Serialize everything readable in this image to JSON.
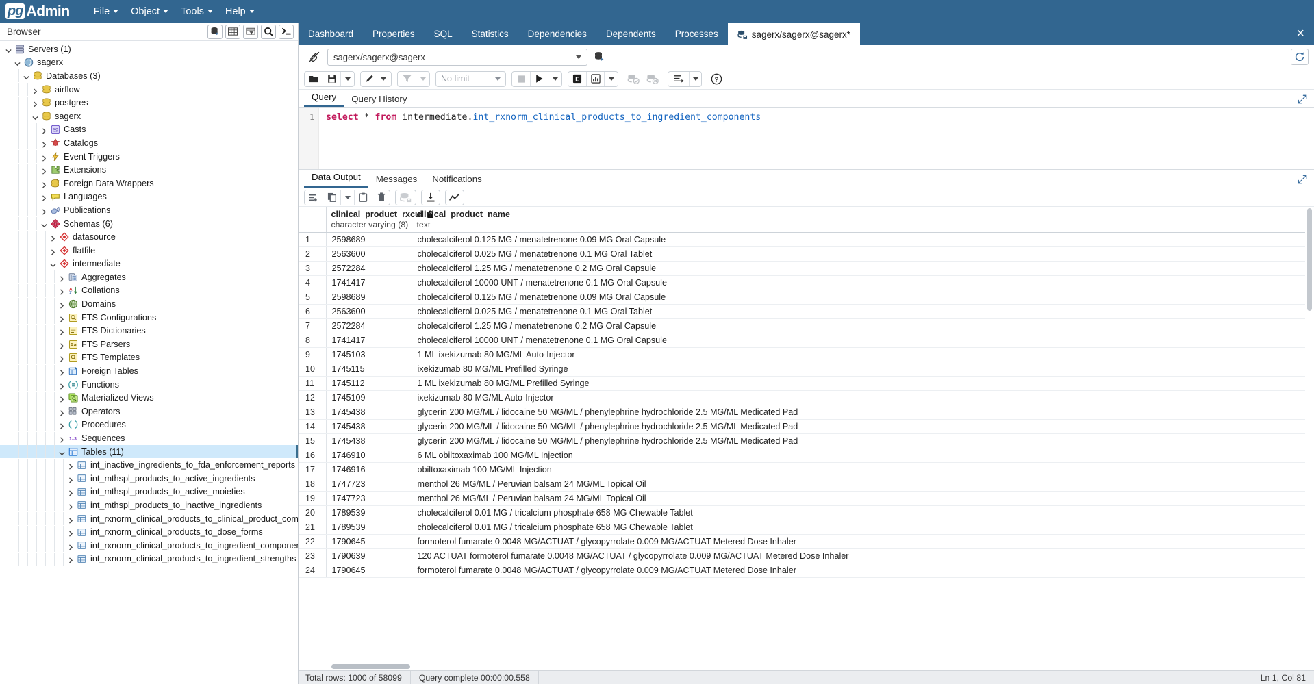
{
  "app": {
    "brand_pg": "pg",
    "brand_admin": "Admin",
    "menu": [
      {
        "label": "File",
        "name": "menu-file"
      },
      {
        "label": "Object",
        "name": "menu-object"
      },
      {
        "label": "Tools",
        "name": "menu-tools"
      },
      {
        "label": "Help",
        "name": "menu-help"
      }
    ],
    "colors": {
      "brand": "#326690",
      "selection": "#cfe9fb",
      "accent_tab": "#326690",
      "keyword": "#c2185b",
      "identifier": "#1565c0"
    }
  },
  "browser": {
    "title": "Browser",
    "tools": [
      {
        "name": "browser-add-server-icon",
        "title": "add-server"
      },
      {
        "name": "browser-grid-icon",
        "title": "grid-view"
      },
      {
        "name": "browser-filter-icon",
        "title": "filtered-rows"
      },
      {
        "name": "browser-search-icon",
        "title": "search-objects"
      },
      {
        "name": "browser-terminal-icon",
        "title": "psql-tool"
      }
    ],
    "tree": [
      {
        "label": "Servers (1)",
        "depth": 0,
        "state": "open",
        "icon": "servers",
        "selected": false
      },
      {
        "label": "sagerx",
        "depth": 1,
        "state": "open",
        "icon": "pgserver",
        "selected": false
      },
      {
        "label": "Databases (3)",
        "depth": 2,
        "state": "open",
        "icon": "database",
        "selected": false
      },
      {
        "label": "airflow",
        "depth": 3,
        "state": "closed",
        "icon": "database",
        "selected": false
      },
      {
        "label": "postgres",
        "depth": 3,
        "state": "closed",
        "icon": "database",
        "selected": false
      },
      {
        "label": "sagerx",
        "depth": 3,
        "state": "open",
        "icon": "database",
        "selected": false
      },
      {
        "label": "Casts",
        "depth": 4,
        "state": "closed",
        "icon": "cast",
        "selected": false
      },
      {
        "label": "Catalogs",
        "depth": 4,
        "state": "closed",
        "icon": "catalog",
        "selected": false
      },
      {
        "label": "Event Triggers",
        "depth": 4,
        "state": "closed",
        "icon": "trigger",
        "selected": false
      },
      {
        "label": "Extensions",
        "depth": 4,
        "state": "closed",
        "icon": "extension",
        "selected": false
      },
      {
        "label": "Foreign Data Wrappers",
        "depth": 4,
        "state": "closed",
        "icon": "fdw",
        "selected": false
      },
      {
        "label": "Languages",
        "depth": 4,
        "state": "closed",
        "icon": "language",
        "selected": false
      },
      {
        "label": "Publications",
        "depth": 4,
        "state": "closed",
        "icon": "publication",
        "selected": false
      },
      {
        "label": "Schemas (6)",
        "depth": 4,
        "state": "open",
        "icon": "schemas",
        "selected": false
      },
      {
        "label": "datasource",
        "depth": 5,
        "state": "closed",
        "icon": "schema",
        "selected": false
      },
      {
        "label": "flatfile",
        "depth": 5,
        "state": "closed",
        "icon": "schema",
        "selected": false
      },
      {
        "label": "intermediate",
        "depth": 5,
        "state": "open",
        "icon": "schema",
        "selected": false
      },
      {
        "label": "Aggregates",
        "depth": 6,
        "state": "closed",
        "icon": "aggregate",
        "selected": false
      },
      {
        "label": "Collations",
        "depth": 6,
        "state": "closed",
        "icon": "collation",
        "selected": false
      },
      {
        "label": "Domains",
        "depth": 6,
        "state": "closed",
        "icon": "domain",
        "selected": false
      },
      {
        "label": "FTS Configurations",
        "depth": 6,
        "state": "closed",
        "icon": "fts",
        "selected": false
      },
      {
        "label": "FTS Dictionaries",
        "depth": 6,
        "state": "closed",
        "icon": "ftsdict",
        "selected": false
      },
      {
        "label": "FTS Parsers",
        "depth": 6,
        "state": "closed",
        "icon": "ftsparser",
        "selected": false
      },
      {
        "label": "FTS Templates",
        "depth": 6,
        "state": "closed",
        "icon": "ftstpl",
        "selected": false
      },
      {
        "label": "Foreign Tables",
        "depth": 6,
        "state": "closed",
        "icon": "foreigntable",
        "selected": false
      },
      {
        "label": "Functions",
        "depth": 6,
        "state": "closed",
        "icon": "function",
        "selected": false
      },
      {
        "label": "Materialized Views",
        "depth": 6,
        "state": "closed",
        "icon": "matview",
        "selected": false
      },
      {
        "label": "Operators",
        "depth": 6,
        "state": "closed",
        "icon": "operator",
        "selected": false
      },
      {
        "label": "Procedures",
        "depth": 6,
        "state": "closed",
        "icon": "procedure",
        "selected": false
      },
      {
        "label": "Sequences",
        "depth": 6,
        "state": "closed",
        "icon": "sequence",
        "selected": false
      },
      {
        "label": "Tables (11)",
        "depth": 6,
        "state": "open",
        "icon": "tables",
        "selected": true
      },
      {
        "label": "int_inactive_ingredients_to_fda_enforcement_reports",
        "depth": 7,
        "state": "closed",
        "icon": "table",
        "selected": false
      },
      {
        "label": "int_mthspl_products_to_active_ingredients",
        "depth": 7,
        "state": "closed",
        "icon": "table",
        "selected": false
      },
      {
        "label": "int_mthspl_products_to_active_moieties",
        "depth": 7,
        "state": "closed",
        "icon": "table",
        "selected": false
      },
      {
        "label": "int_mthspl_products_to_inactive_ingredients",
        "depth": 7,
        "state": "closed",
        "icon": "table",
        "selected": false
      },
      {
        "label": "int_rxnorm_clinical_products_to_clinical_product_componen",
        "depth": 7,
        "state": "closed",
        "icon": "table",
        "selected": false
      },
      {
        "label": "int_rxnorm_clinical_products_to_dose_forms",
        "depth": 7,
        "state": "closed",
        "icon": "table",
        "selected": false
      },
      {
        "label": "int_rxnorm_clinical_products_to_ingredient_components",
        "depth": 7,
        "state": "closed",
        "icon": "table",
        "selected": false
      },
      {
        "label": "int_rxnorm_clinical_products_to_ingredient_strengths",
        "depth": 7,
        "state": "closed",
        "icon": "table",
        "selected": false
      }
    ]
  },
  "object_tabs": {
    "items": [
      {
        "label": "Dashboard",
        "active": false,
        "icon": null
      },
      {
        "label": "Properties",
        "active": false,
        "icon": null
      },
      {
        "label": "SQL",
        "active": false,
        "icon": null
      },
      {
        "label": "Statistics",
        "active": false,
        "icon": null
      },
      {
        "label": "Dependencies",
        "active": false,
        "icon": null
      },
      {
        "label": "Dependents",
        "active": false,
        "icon": null
      },
      {
        "label": "Processes",
        "active": false,
        "icon": null
      },
      {
        "label": "sagerx/sagerx@sagerx*",
        "active": true,
        "icon": "database-query"
      }
    ],
    "close_label": "×"
  },
  "connection": {
    "value": "sagerx/sagerx@sagerx",
    "chevron": "⌄"
  },
  "query_toolbar": {
    "limit_label": "No limit",
    "buttons": [
      {
        "name": "open-file-button",
        "title": "Open File"
      },
      {
        "name": "save-file-button",
        "title": "Save File"
      },
      {
        "name": "save-dropdown-button",
        "title": "Save options"
      },
      {
        "name": "edit-button",
        "title": "Edit"
      },
      {
        "name": "edit-dropdown-button",
        "title": "Edit options"
      },
      {
        "name": "filter-button",
        "title": "Filter"
      },
      {
        "name": "filter-dropdown-button",
        "title": "Filter options"
      },
      {
        "name": "stop-query-button",
        "title": "Stop"
      },
      {
        "name": "execute-query-button",
        "title": "Execute/Refresh"
      },
      {
        "name": "execute-dropdown-button",
        "title": "Execute options"
      },
      {
        "name": "explain-button",
        "title": "Explain"
      },
      {
        "name": "explain-analyze-button",
        "title": "Explain Analyze"
      },
      {
        "name": "explain-dropdown-button",
        "title": "Explain options"
      },
      {
        "name": "commit-button",
        "title": "Commit"
      },
      {
        "name": "rollback-button",
        "title": "Rollback"
      },
      {
        "name": "macros-button",
        "title": "Macros"
      },
      {
        "name": "help-button",
        "title": "Help"
      }
    ]
  },
  "query_tabs": {
    "items": [
      {
        "label": "Query",
        "active": true
      },
      {
        "label": "Query History",
        "active": false
      }
    ]
  },
  "editor": {
    "line_number": "1",
    "tokens": [
      {
        "text": "select",
        "type": "kw"
      },
      {
        "text": " ",
        "type": "plain"
      },
      {
        "text": "*",
        "type": "op"
      },
      {
        "text": " ",
        "type": "plain"
      },
      {
        "text": "from",
        "type": "kw"
      },
      {
        "text": " ",
        "type": "plain"
      },
      {
        "text": "intermediate.",
        "type": "plain"
      },
      {
        "text": "int_rxnorm_clinical_products_to_ingredient_components",
        "type": "ident"
      }
    ]
  },
  "output_tabs": {
    "items": [
      {
        "label": "Data Output",
        "active": true
      },
      {
        "label": "Messages",
        "active": false
      },
      {
        "label": "Notifications",
        "active": false
      }
    ]
  },
  "grid_toolbar": {
    "buttons": [
      {
        "name": "add-row-button",
        "title": "Add row"
      },
      {
        "name": "copy-button",
        "title": "Copy"
      },
      {
        "name": "copy-dropdown-button",
        "title": "Copy options"
      },
      {
        "name": "paste-button",
        "title": "Paste"
      },
      {
        "name": "delete-button",
        "title": "Delete row"
      },
      {
        "name": "save-data-changes-button",
        "title": "Save Data Changes"
      },
      {
        "name": "download-csv-button",
        "title": "Download as CSV"
      },
      {
        "name": "graph-visualiser-button",
        "title": "Graph Visualiser"
      }
    ]
  },
  "grid": {
    "columns": [
      {
        "name": "clinical_product_rxcui",
        "type": "character varying (8)",
        "locked": true
      },
      {
        "name": "clinical_product_name",
        "type": "text",
        "locked": false
      }
    ],
    "rows": [
      {
        "n": "1",
        "rxcui": "2598689",
        "name": "cholecalciferol 0.125 MG / menatetrenone 0.09 MG Oral Capsule"
      },
      {
        "n": "2",
        "rxcui": "2563600",
        "name": "cholecalciferol 0.025 MG / menatetrenone 0.1 MG Oral Tablet"
      },
      {
        "n": "3",
        "rxcui": "2572284",
        "name": "cholecalciferol 1.25 MG / menatetrenone 0.2 MG Oral Capsule"
      },
      {
        "n": "4",
        "rxcui": "1741417",
        "name": "cholecalciferol 10000 UNT / menatetrenone 0.1 MG Oral Capsule"
      },
      {
        "n": "5",
        "rxcui": "2598689",
        "name": "cholecalciferol 0.125 MG / menatetrenone 0.09 MG Oral Capsule"
      },
      {
        "n": "6",
        "rxcui": "2563600",
        "name": "cholecalciferol 0.025 MG / menatetrenone 0.1 MG Oral Tablet"
      },
      {
        "n": "7",
        "rxcui": "2572284",
        "name": "cholecalciferol 1.25 MG / menatetrenone 0.2 MG Oral Capsule"
      },
      {
        "n": "8",
        "rxcui": "1741417",
        "name": "cholecalciferol 10000 UNT / menatetrenone 0.1 MG Oral Capsule"
      },
      {
        "n": "9",
        "rxcui": "1745103",
        "name": "1 ML ixekizumab 80 MG/ML Auto-Injector"
      },
      {
        "n": "10",
        "rxcui": "1745115",
        "name": "ixekizumab 80 MG/ML Prefilled Syringe"
      },
      {
        "n": "11",
        "rxcui": "1745112",
        "name": "1 ML ixekizumab 80 MG/ML Prefilled Syringe"
      },
      {
        "n": "12",
        "rxcui": "1745109",
        "name": "ixekizumab 80 MG/ML Auto-Injector"
      },
      {
        "n": "13",
        "rxcui": "1745438",
        "name": "glycerin 200 MG/ML / lidocaine 50 MG/ML / phenylephrine hydrochloride 2.5 MG/ML Medicated Pad"
      },
      {
        "n": "14",
        "rxcui": "1745438",
        "name": "glycerin 200 MG/ML / lidocaine 50 MG/ML / phenylephrine hydrochloride 2.5 MG/ML Medicated Pad"
      },
      {
        "n": "15",
        "rxcui": "1745438",
        "name": "glycerin 200 MG/ML / lidocaine 50 MG/ML / phenylephrine hydrochloride 2.5 MG/ML Medicated Pad"
      },
      {
        "n": "16",
        "rxcui": "1746910",
        "name": "6 ML obiltoxaximab 100 MG/ML Injection"
      },
      {
        "n": "17",
        "rxcui": "1746916",
        "name": "obiltoxaximab 100 MG/ML Injection"
      },
      {
        "n": "18",
        "rxcui": "1747723",
        "name": "menthol 26 MG/ML / Peruvian balsam 24 MG/ML Topical Oil"
      },
      {
        "n": "19",
        "rxcui": "1747723",
        "name": "menthol 26 MG/ML / Peruvian balsam 24 MG/ML Topical Oil"
      },
      {
        "n": "20",
        "rxcui": "1789539",
        "name": "cholecalciferol 0.01 MG / tricalcium phosphate 658 MG Chewable Tablet"
      },
      {
        "n": "21",
        "rxcui": "1789539",
        "name": "cholecalciferol 0.01 MG / tricalcium phosphate 658 MG Chewable Tablet"
      },
      {
        "n": "22",
        "rxcui": "1790645",
        "name": "formoterol fumarate 0.0048 MG/ACTUAT / glycopyrrolate 0.009 MG/ACTUAT Metered Dose Inhaler"
      },
      {
        "n": "23",
        "rxcui": "1790639",
        "name": "120 ACTUAT formoterol fumarate 0.0048 MG/ACTUAT / glycopyrrolate 0.009 MG/ACTUAT Metered Dose Inhaler"
      },
      {
        "n": "24",
        "rxcui": "1790645",
        "name": "formoterol fumarate 0.0048 MG/ACTUAT / glycopyrrolate 0.009 MG/ACTUAT Metered Dose Inhaler"
      }
    ]
  },
  "statusbar": {
    "total_rows": "Total rows: 1000 of 58099",
    "query_complete": "Query complete 00:00:00.558",
    "cursor_position": "Ln 1, Col 81"
  }
}
